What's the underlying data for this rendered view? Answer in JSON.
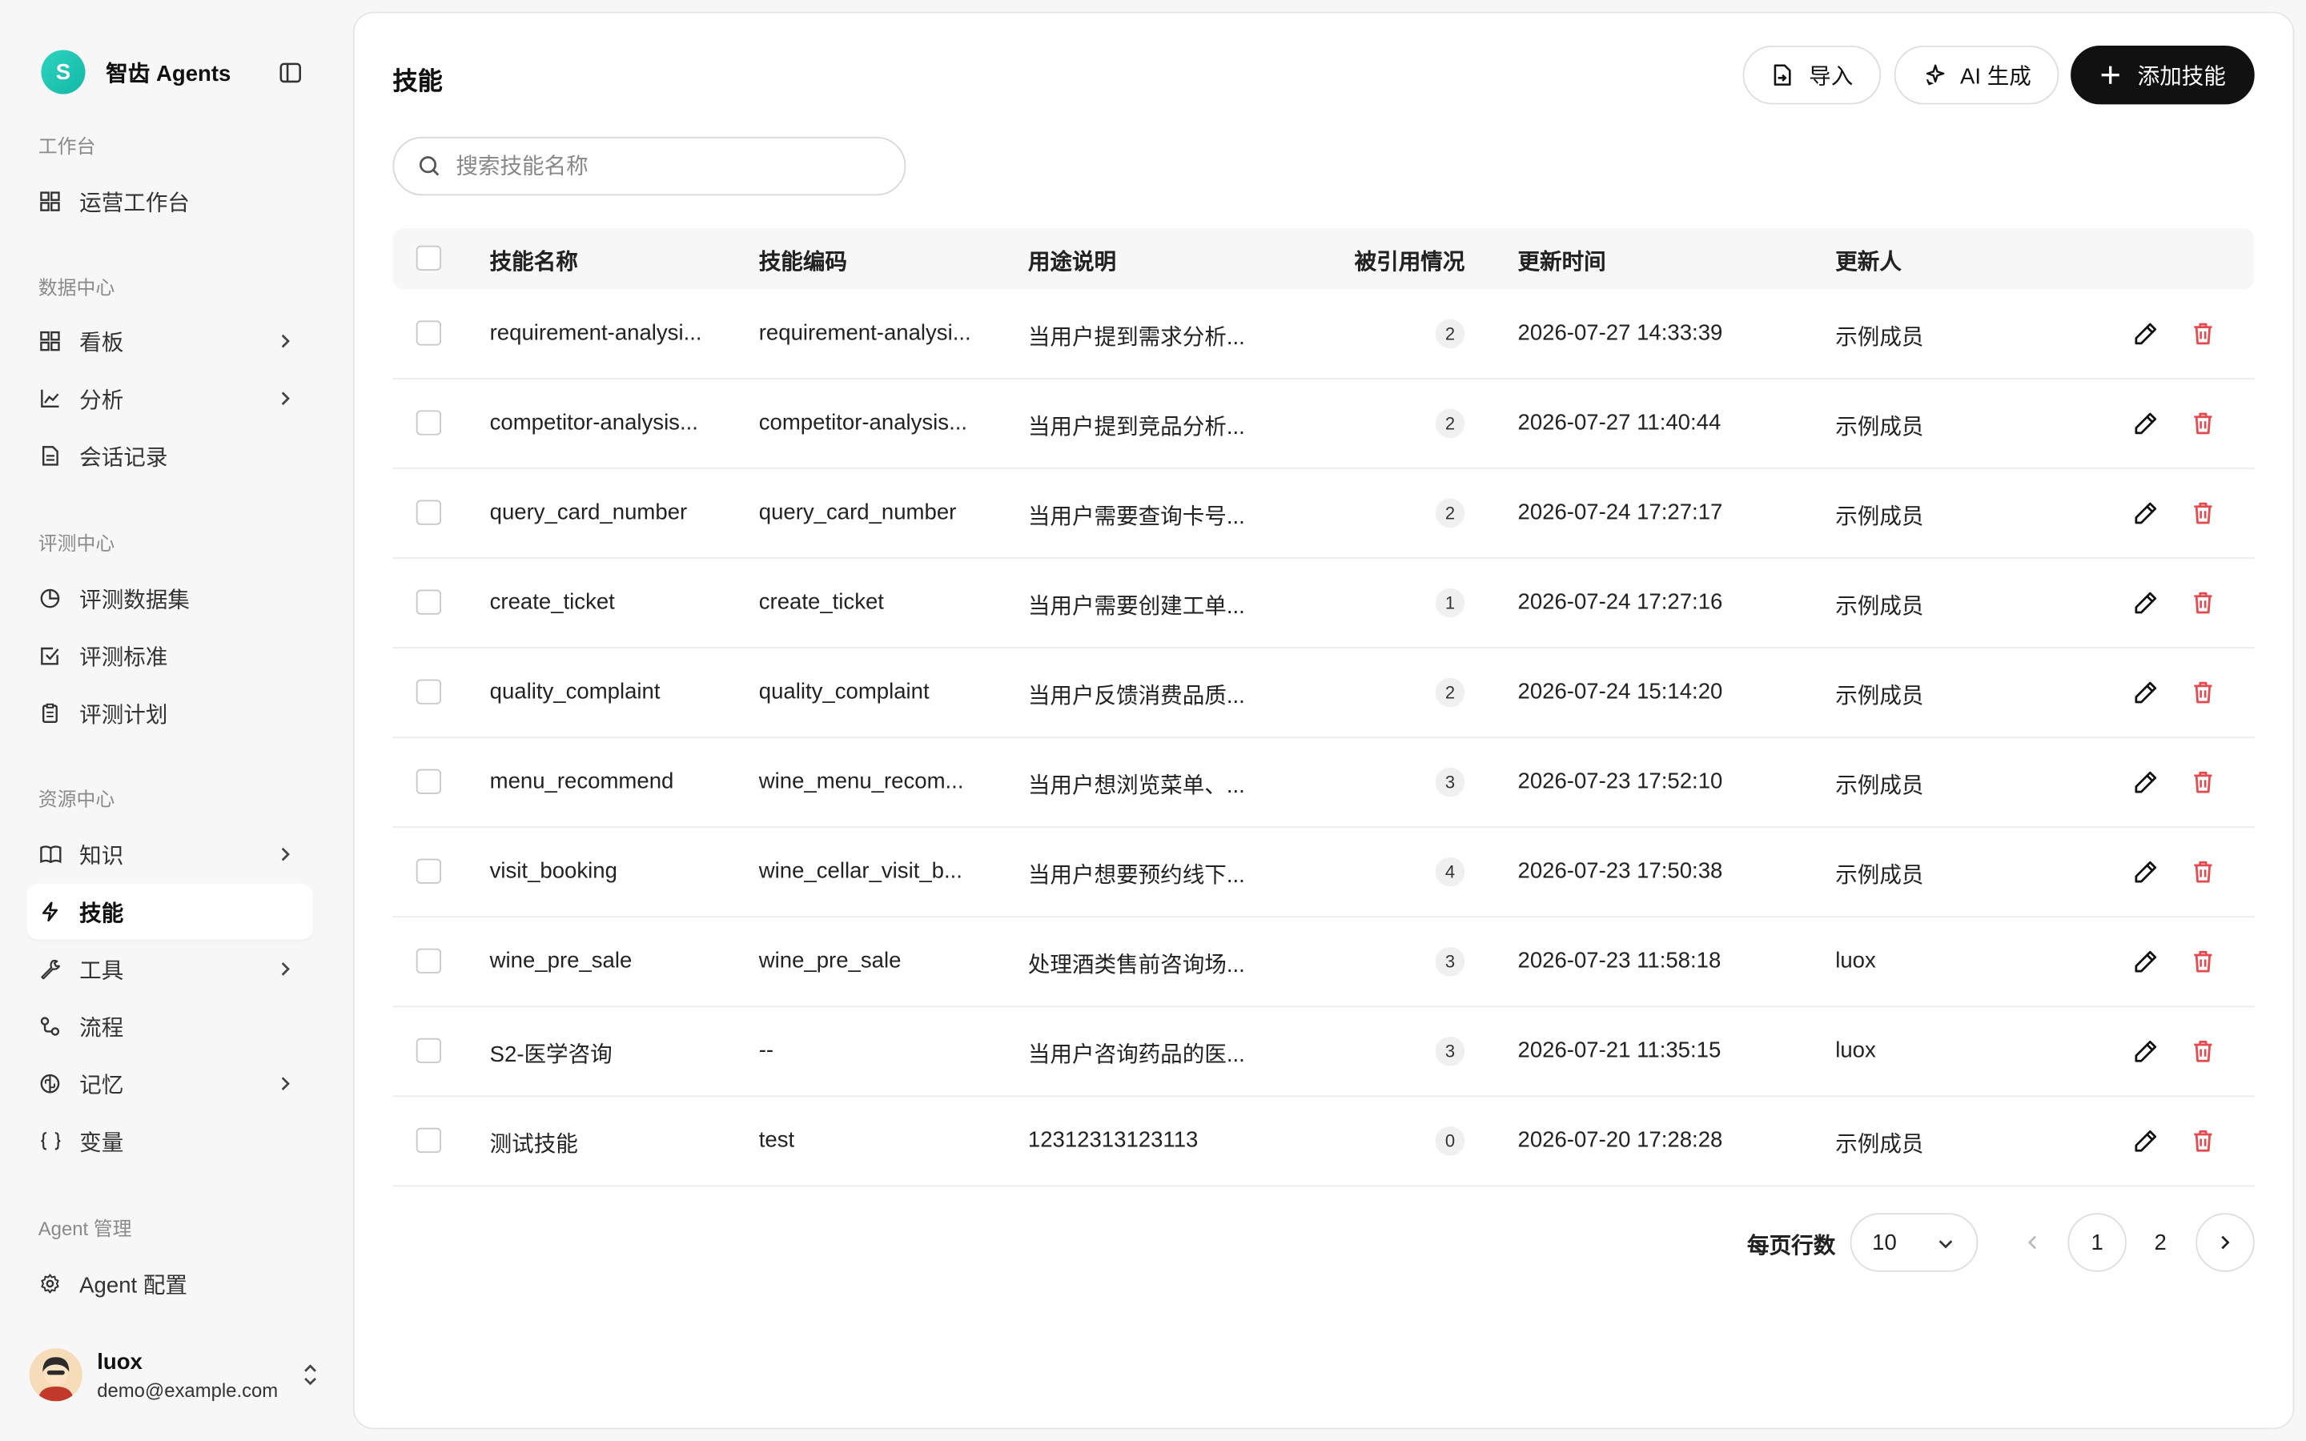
{
  "sidebar": {
    "brand": {
      "logo_letter": "S",
      "name": "智齿 Agents"
    },
    "sections": [
      {
        "title": "工作台"
      },
      {
        "title": "数据中心"
      },
      {
        "title": "评测中心"
      },
      {
        "title": "资源中心"
      },
      {
        "title": "Agent 管理"
      }
    ],
    "items": [
      {
        "label": "运营工作台",
        "icon": "grid-icon"
      },
      {
        "label": "看板",
        "icon": "grid-icon"
      },
      {
        "label": "分析",
        "icon": "chart-icon"
      },
      {
        "label": "会话记录",
        "icon": "document-icon"
      },
      {
        "label": "评测数据集",
        "icon": "pie-icon"
      },
      {
        "label": "评测标准",
        "icon": "checkbox-icon"
      },
      {
        "label": "评测计划",
        "icon": "clipboard-icon"
      },
      {
        "label": "知识",
        "icon": "book-icon"
      },
      {
        "label": "技能",
        "icon": "lightning-icon"
      },
      {
        "label": "工具",
        "icon": "wrench-icon"
      },
      {
        "label": "流程",
        "icon": "flow-icon"
      },
      {
        "label": "记忆",
        "icon": "brain-icon"
      },
      {
        "label": "变量",
        "icon": "braces-icon"
      },
      {
        "label": "Agent 配置",
        "icon": "gear-icon"
      }
    ],
    "user": {
      "name": "luox",
      "email": "demo@example.com"
    }
  },
  "header": {
    "title": "技能",
    "import_label": "导入",
    "ai_label": "AI 生成",
    "add_label": "添加技能"
  },
  "search": {
    "placeholder": "搜索技能名称",
    "value": ""
  },
  "table": {
    "columns": [
      "技能名称",
      "技能编码",
      "用途说明",
      "被引用情况",
      "更新时间",
      "更新人"
    ],
    "rows": [
      {
        "name": "requirement-analysi...",
        "code": "requirement-analysi...",
        "desc": "当用户提到需求分析...",
        "refs": "2",
        "updated": "2026-07-27 14:33:39",
        "updater": "示例成员"
      },
      {
        "name": "competitor-analysis...",
        "code": "competitor-analysis...",
        "desc": "当用户提到竞品分析...",
        "refs": "2",
        "updated": "2026-07-27 11:40:44",
        "updater": "示例成员"
      },
      {
        "name": "query_card_number",
        "code": "query_card_number",
        "desc": "当用户需要查询卡号...",
        "refs": "2",
        "updated": "2026-07-24 17:27:17",
        "updater": "示例成员"
      },
      {
        "name": "create_ticket",
        "code": "create_ticket",
        "desc": "当用户需要创建工单...",
        "refs": "1",
        "updated": "2026-07-24 17:27:16",
        "updater": "示例成员"
      },
      {
        "name": "quality_complaint",
        "code": "quality_complaint",
        "desc": "当用户反馈消费品质...",
        "refs": "2",
        "updated": "2026-07-24 15:14:20",
        "updater": "示例成员"
      },
      {
        "name": "menu_recommend",
        "code": "wine_menu_recom...",
        "desc": "当用户想浏览菜单、...",
        "refs": "3",
        "updated": "2026-07-23 17:52:10",
        "updater": "示例成员"
      },
      {
        "name": "visit_booking",
        "code": "wine_cellar_visit_b...",
        "desc": "当用户想要预约线下...",
        "refs": "4",
        "updated": "2026-07-23 17:50:38",
        "updater": "示例成员"
      },
      {
        "name": "wine_pre_sale",
        "code": "wine_pre_sale",
        "desc": "处理酒类售前咨询场...",
        "refs": "3",
        "updated": "2026-07-23 11:58:18",
        "updater": "luox"
      },
      {
        "name": "S2-医学咨询",
        "code": "--",
        "desc": "当用户咨询药品的医...",
        "refs": "3",
        "updated": "2026-07-21 11:35:15",
        "updater": "luox"
      },
      {
        "name": "测试技能",
        "code": "test",
        "desc": "12312313123113",
        "refs": "0",
        "updated": "2026-07-20 17:28:28",
        "updater": "示例成员"
      }
    ]
  },
  "pagination": {
    "per_page_label": "每页行数",
    "per_page_value": "10",
    "pages": [
      "1",
      "2"
    ],
    "current_page": "1"
  },
  "colors": {
    "accent": "#111111",
    "brand": "#14b8a6",
    "danger": "#e5484d"
  }
}
